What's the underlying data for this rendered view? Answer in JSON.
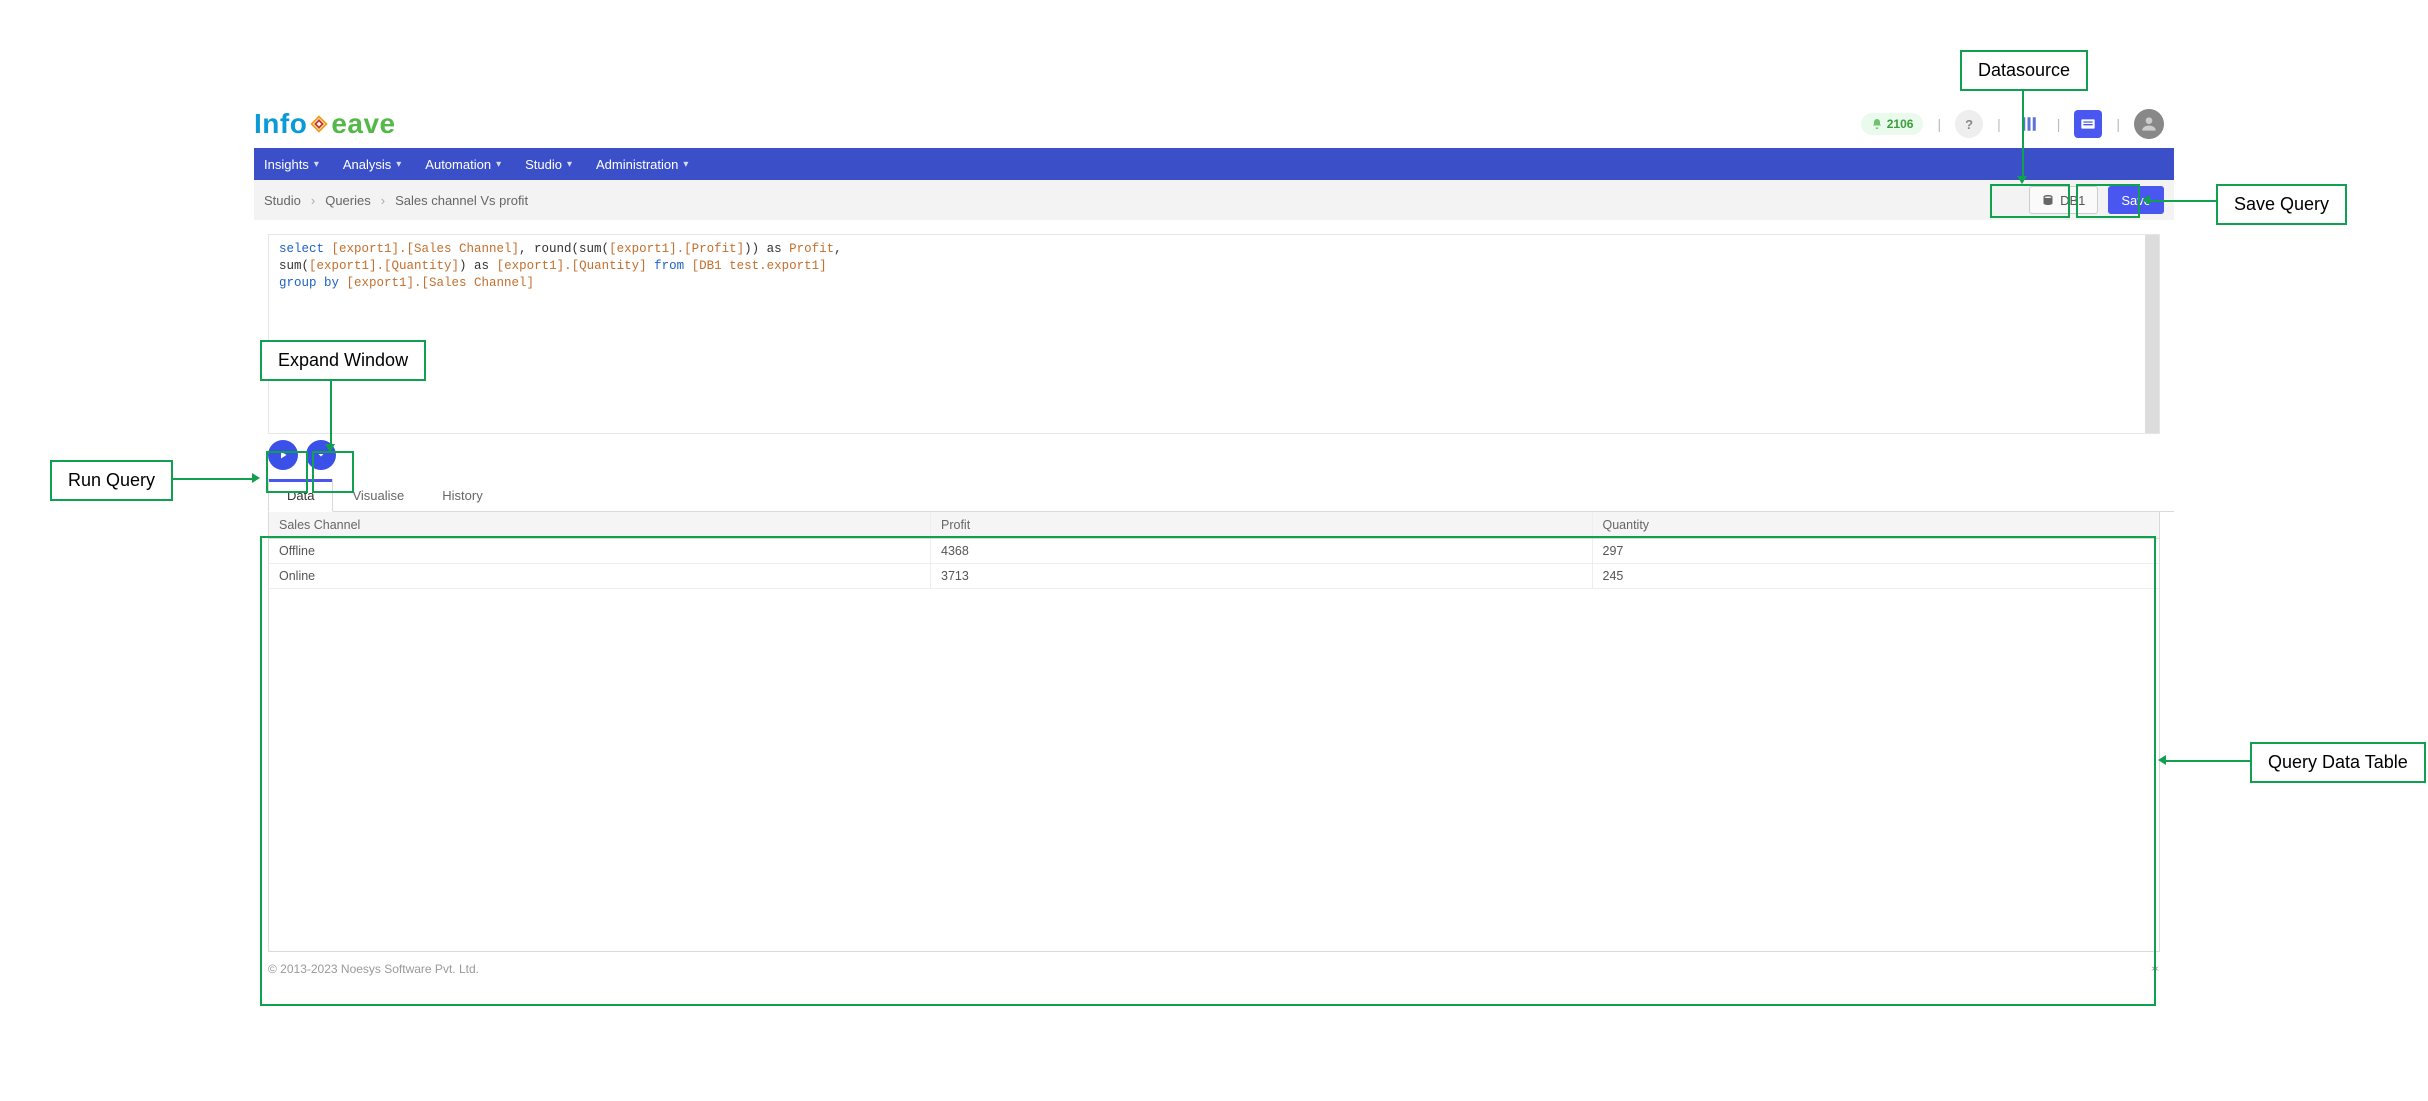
{
  "logo": {
    "part1": "Info",
    "part3": "eave"
  },
  "header": {
    "notif_count": "2106"
  },
  "nav": {
    "items": [
      {
        "label": "Insights"
      },
      {
        "label": "Analysis"
      },
      {
        "label": "Automation"
      },
      {
        "label": "Studio"
      },
      {
        "label": "Administration"
      }
    ]
  },
  "crumbs": {
    "a": "Studio",
    "b": "Queries",
    "c": "Sales channel Vs profit"
  },
  "actions": {
    "datasource_label": "DB1",
    "save_label": "Save"
  },
  "editor": {
    "line1_a": "select ",
    "line1_b": "[export1].[Sales Channel]",
    "line1_c": ", round(sum(",
    "line1_d": "[export1].[Profit]",
    "line1_e": ")) as ",
    "line1_f": "Profit",
    "line1_g": ",",
    "line2_a": "sum(",
    "line2_b": "[export1].[Quantity]",
    "line2_c": ") as ",
    "line2_d": "[export1].[Quantity]",
    "line2_e": " from ",
    "line2_f": "[DB1 test.export1]",
    "line3_a": "group by ",
    "line3_b": "[export1].[Sales Channel]"
  },
  "tabs": {
    "data": "Data",
    "vis": "Visualise",
    "hist": "History"
  },
  "table": {
    "columns": [
      "Sales Channel",
      "Profit",
      "Quantity"
    ],
    "rows": [
      {
        "c0": "Offline",
        "c1": "4368",
        "c2": "297"
      },
      {
        "c0": "Online",
        "c1": "3713",
        "c2": "245"
      }
    ]
  },
  "footer": {
    "copyright": "© 2013-2023 Noesys Software Pvt. Ltd."
  },
  "callouts": {
    "run_query": "Run Query",
    "expand_window": "Expand Window",
    "datasource": "Datasource",
    "save_query": "Save Query",
    "query_table": "Query Data Table"
  }
}
